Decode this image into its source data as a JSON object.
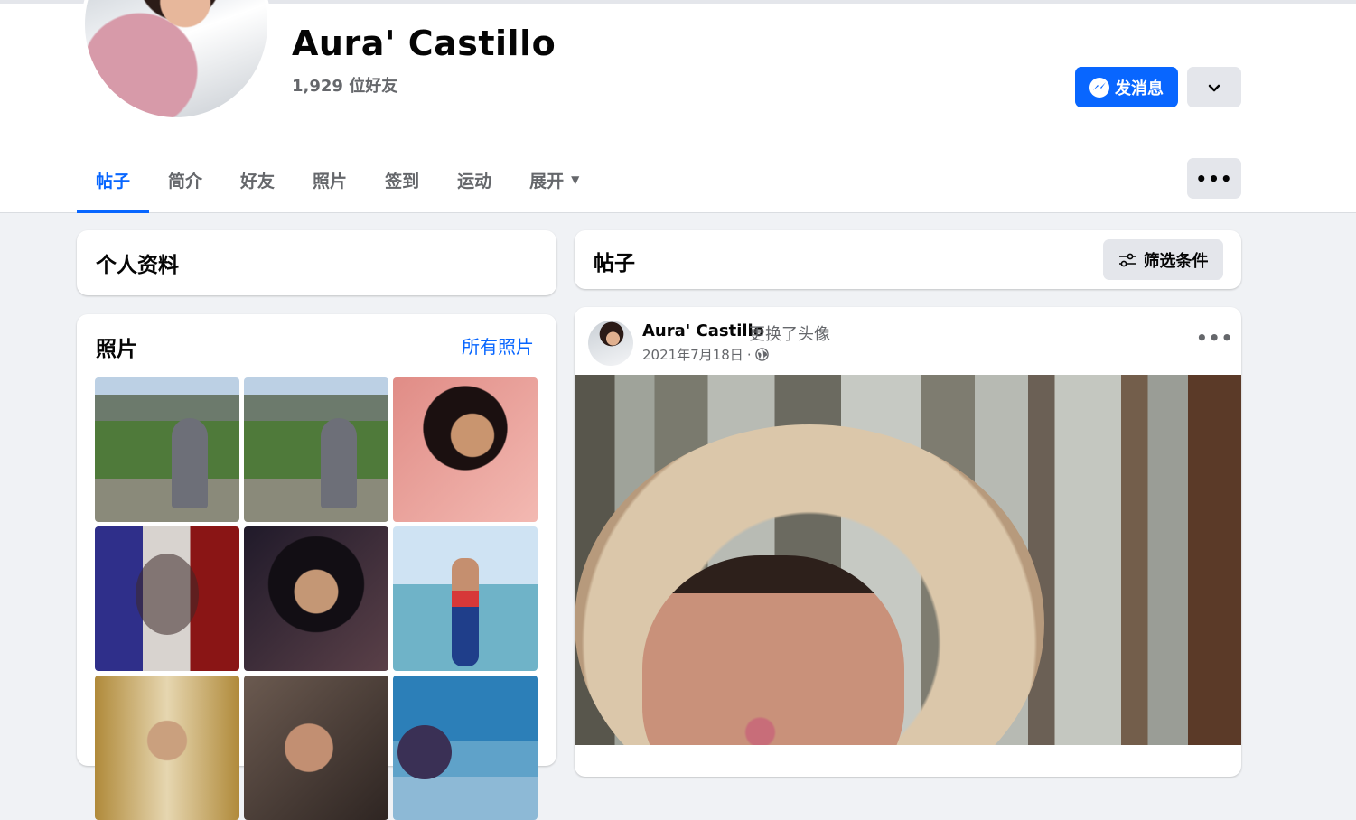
{
  "profile": {
    "name": "Aura' Castillo",
    "friends_count": "1,929 位好友"
  },
  "actions": {
    "message_label": "发消息",
    "message_icon": "messenger-icon",
    "more_dropdown_icon": "chevron-down-icon"
  },
  "tabs": [
    {
      "label": "帖子",
      "active": true
    },
    {
      "label": "简介",
      "active": false
    },
    {
      "label": "好友",
      "active": false
    },
    {
      "label": "照片",
      "active": false
    },
    {
      "label": "签到",
      "active": false
    },
    {
      "label": "运动",
      "active": false
    },
    {
      "label": "展开",
      "active": false,
      "has_caret": true
    }
  ],
  "tab_more_icon": "ellipsis-icon",
  "left": {
    "intro_title": "个人资料",
    "photos_title": "照片",
    "all_photos_link": "所有照片",
    "photo_count_visible": 9
  },
  "posts_header": {
    "title": "帖子",
    "filter_label": "筛选条件",
    "filter_icon": "sliders-icon"
  },
  "post": {
    "author": "Aura' Castillo",
    "action": "更换了头像",
    "date": "2021年7月18日",
    "separator": "·",
    "privacy_icon": "globe-icon",
    "menu_icon": "ellipsis-icon"
  },
  "colors": {
    "accent": "#0866ff",
    "background": "#f0f2f5",
    "secondary_text": "#65676b",
    "button_gray": "#e4e6eb"
  }
}
